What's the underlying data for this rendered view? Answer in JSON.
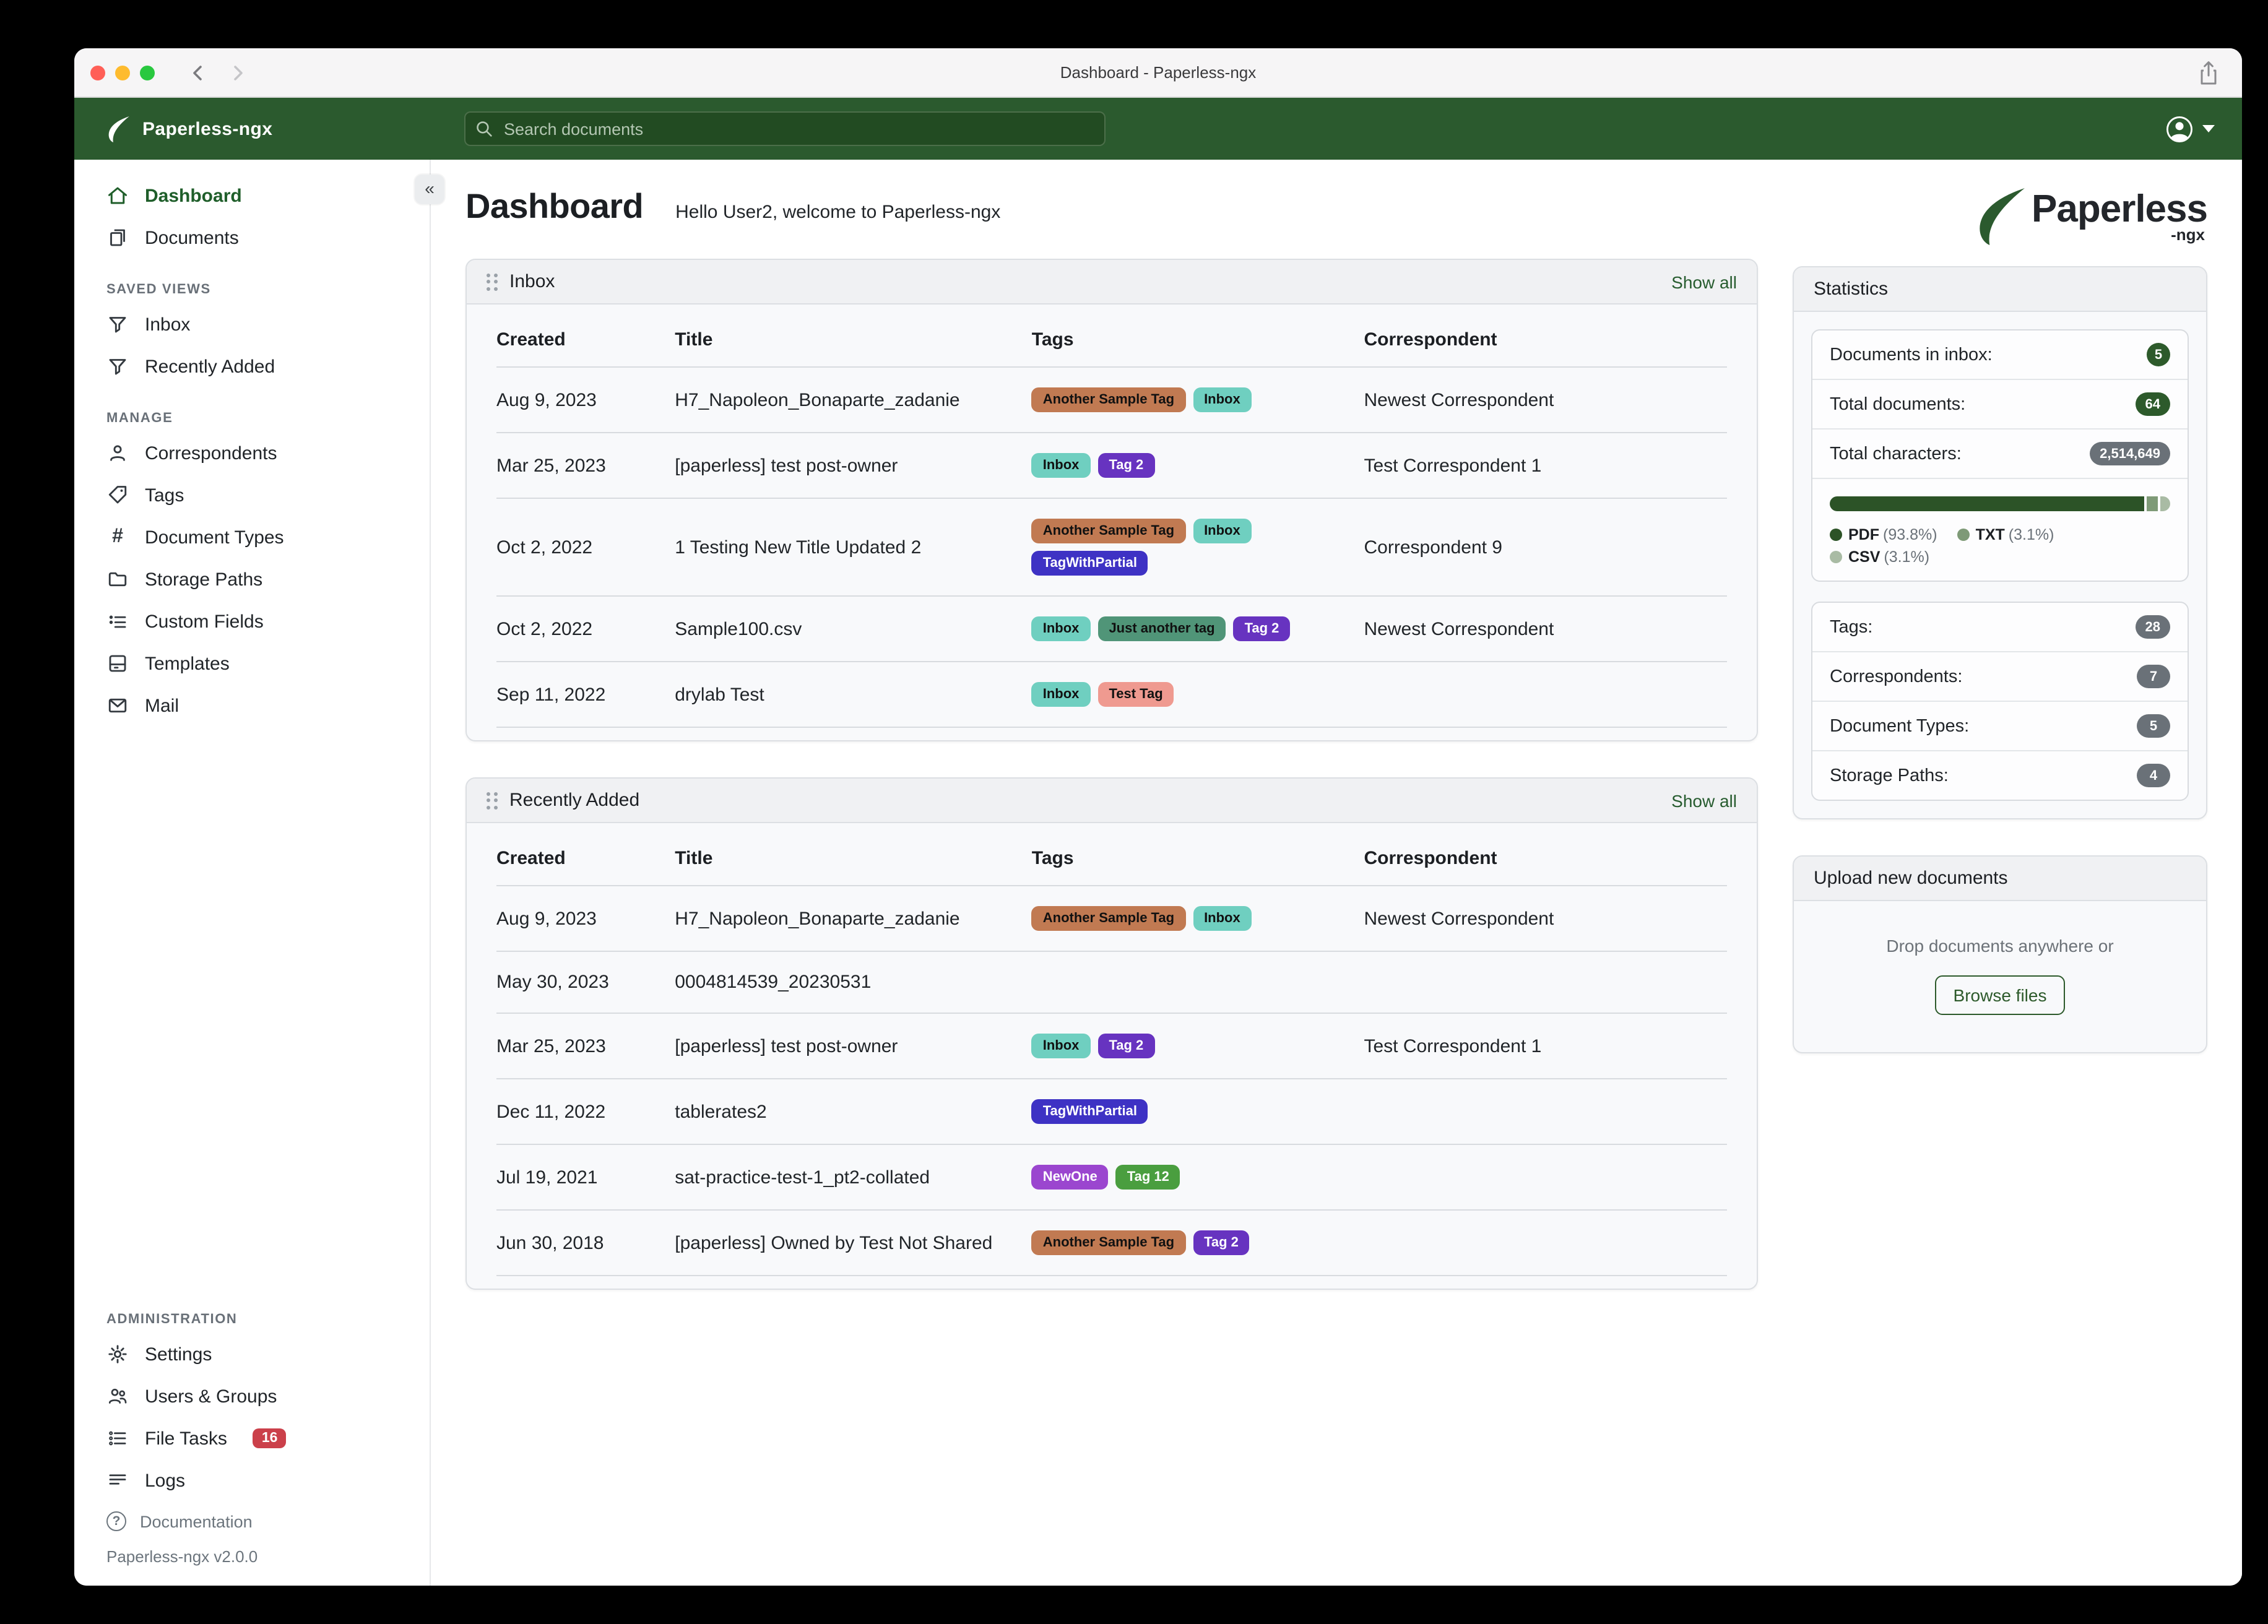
{
  "window": {
    "title": "Dashboard - Paperless-ngx"
  },
  "navbar": {
    "brand": "Paperless-ngx",
    "search_placeholder": "Search documents"
  },
  "sidebar": {
    "dashboard": "Dashboard",
    "documents": "Documents",
    "saved_views_heading": "SAVED VIEWS",
    "inbox": "Inbox",
    "recently_added": "Recently Added",
    "manage_heading": "MANAGE",
    "correspondents": "Correspondents",
    "tags": "Tags",
    "document_types": "Document Types",
    "storage_paths": "Storage Paths",
    "custom_fields": "Custom Fields",
    "templates": "Templates",
    "mail": "Mail",
    "administration_heading": "ADMINISTRATION",
    "settings": "Settings",
    "users_groups": "Users & Groups",
    "file_tasks": "File Tasks",
    "file_tasks_count": "16",
    "logs": "Logs",
    "documentation": "Documentation",
    "version": "Paperless-ngx v2.0.0"
  },
  "page": {
    "title": "Dashboard",
    "greeting": "Hello User2, welcome to Paperless-ngx"
  },
  "logo": {
    "brand": "Paperless",
    "suffix": "-ngx"
  },
  "tag_styles": {
    "Inbox": {
      "bg": "#6fcfc0",
      "fg": "#111111"
    },
    "Another Sample Tag": {
      "bg": "#c17a52",
      "fg": "#111111"
    },
    "Tag 2": {
      "bg": "#6733c0",
      "fg": "#ffffff"
    },
    "TagWithPartial": {
      "bg": "#3e32c4",
      "fg": "#ffffff"
    },
    "Just another tag": {
      "bg": "#509578",
      "fg": "#111111"
    },
    "Test Tag": {
      "bg": "#ef9a90",
      "fg": "#111111"
    },
    "NewOne": {
      "bg": "#9b46cf",
      "fg": "#ffffff"
    },
    "Tag 12": {
      "bg": "#4a9e3f",
      "fg": "#ffffff"
    }
  },
  "inbox_card": {
    "title": "Inbox",
    "show_all": "Show all",
    "columns": [
      "Created",
      "Title",
      "Tags",
      "Correspondent"
    ],
    "rows": [
      {
        "created": "Aug 9, 2023",
        "title": "H7_Napoleon_Bonaparte_zadanie",
        "tags": [
          "Another Sample Tag",
          "Inbox"
        ],
        "correspondent": "Newest Correspondent"
      },
      {
        "created": "Mar 25, 2023",
        "title": "[paperless] test post-owner",
        "tags": [
          "Inbox",
          "Tag 2"
        ],
        "correspondent": "Test Correspondent 1"
      },
      {
        "created": "Oct 2, 2022",
        "title": "1 Testing New Title Updated 2",
        "tags": [
          "Another Sample Tag",
          "Inbox",
          "TagWithPartial"
        ],
        "correspondent": "Correspondent 9"
      },
      {
        "created": "Oct 2, 2022",
        "title": "Sample100.csv",
        "tags": [
          "Inbox",
          "Just another tag",
          "Tag 2"
        ],
        "correspondent": "Newest Correspondent"
      },
      {
        "created": "Sep 11, 2022",
        "title": "drylab Test",
        "tags": [
          "Inbox",
          "Test Tag"
        ],
        "correspondent": ""
      }
    ]
  },
  "recent_card": {
    "title": "Recently Added",
    "show_all": "Show all",
    "columns": [
      "Created",
      "Title",
      "Tags",
      "Correspondent"
    ],
    "rows": [
      {
        "created": "Aug 9, 2023",
        "title": "H7_Napoleon_Bonaparte_zadanie",
        "tags": [
          "Another Sample Tag",
          "Inbox"
        ],
        "correspondent": "Newest Correspondent"
      },
      {
        "created": "May 30, 2023",
        "title": "0004814539_20230531",
        "tags": [],
        "correspondent": ""
      },
      {
        "created": "Mar 25, 2023",
        "title": "[paperless] test post-owner",
        "tags": [
          "Inbox",
          "Tag 2"
        ],
        "correspondent": "Test Correspondent 1"
      },
      {
        "created": "Dec 11, 2022",
        "title": "tablerates2",
        "tags": [
          "TagWithPartial"
        ],
        "correspondent": ""
      },
      {
        "created": "Jul 19, 2021",
        "title": "sat-practice-test-1_pt2-collated",
        "tags": [
          "NewOne",
          "Tag 12"
        ],
        "correspondent": ""
      },
      {
        "created": "Jun 30, 2018",
        "title": "[paperless] Owned by Test Not Shared",
        "tags": [
          "Another Sample Tag",
          "Tag 2"
        ],
        "correspondent": ""
      }
    ]
  },
  "statistics": {
    "title": "Statistics",
    "group1": [
      {
        "label": "Documents in inbox:",
        "value": "5",
        "variant": "green",
        "shape": "circle"
      },
      {
        "label": "Total documents:",
        "value": "64",
        "variant": "green",
        "shape": "pill"
      },
      {
        "label": "Total characters:",
        "value": "2,514,649",
        "variant": "gray",
        "shape": "pill"
      }
    ],
    "file_types": [
      {
        "name": "PDF",
        "pct_label": "(93.8%)",
        "pct": 93.8,
        "color": "#2c5327"
      },
      {
        "name": "TXT",
        "pct_label": "(3.1%)",
        "pct": 3.1,
        "color": "#7e9a77"
      },
      {
        "name": "CSV",
        "pct_label": "(3.1%)",
        "pct": 3.1,
        "color": "#a9bba4"
      }
    ],
    "group2": [
      {
        "label": "Tags:",
        "value": "28",
        "variant": "gray",
        "shape": "pill"
      },
      {
        "label": "Correspondents:",
        "value": "7",
        "variant": "gray",
        "shape": "pill"
      },
      {
        "label": "Document Types:",
        "value": "5",
        "variant": "gray",
        "shape": "pill"
      },
      {
        "label": "Storage Paths:",
        "value": "4",
        "variant": "gray",
        "shape": "pill"
      }
    ]
  },
  "upload_card": {
    "title": "Upload new documents",
    "drop_text": "Drop documents anywhere or",
    "browse_label": "Browse files"
  },
  "colors": {
    "navbar_green": "#2b5a2e",
    "accent_green": "#1f5e2a",
    "badge_green": "#2d5a2b",
    "badge_gray": "#6a7178",
    "badge_red": "#cb404a"
  }
}
